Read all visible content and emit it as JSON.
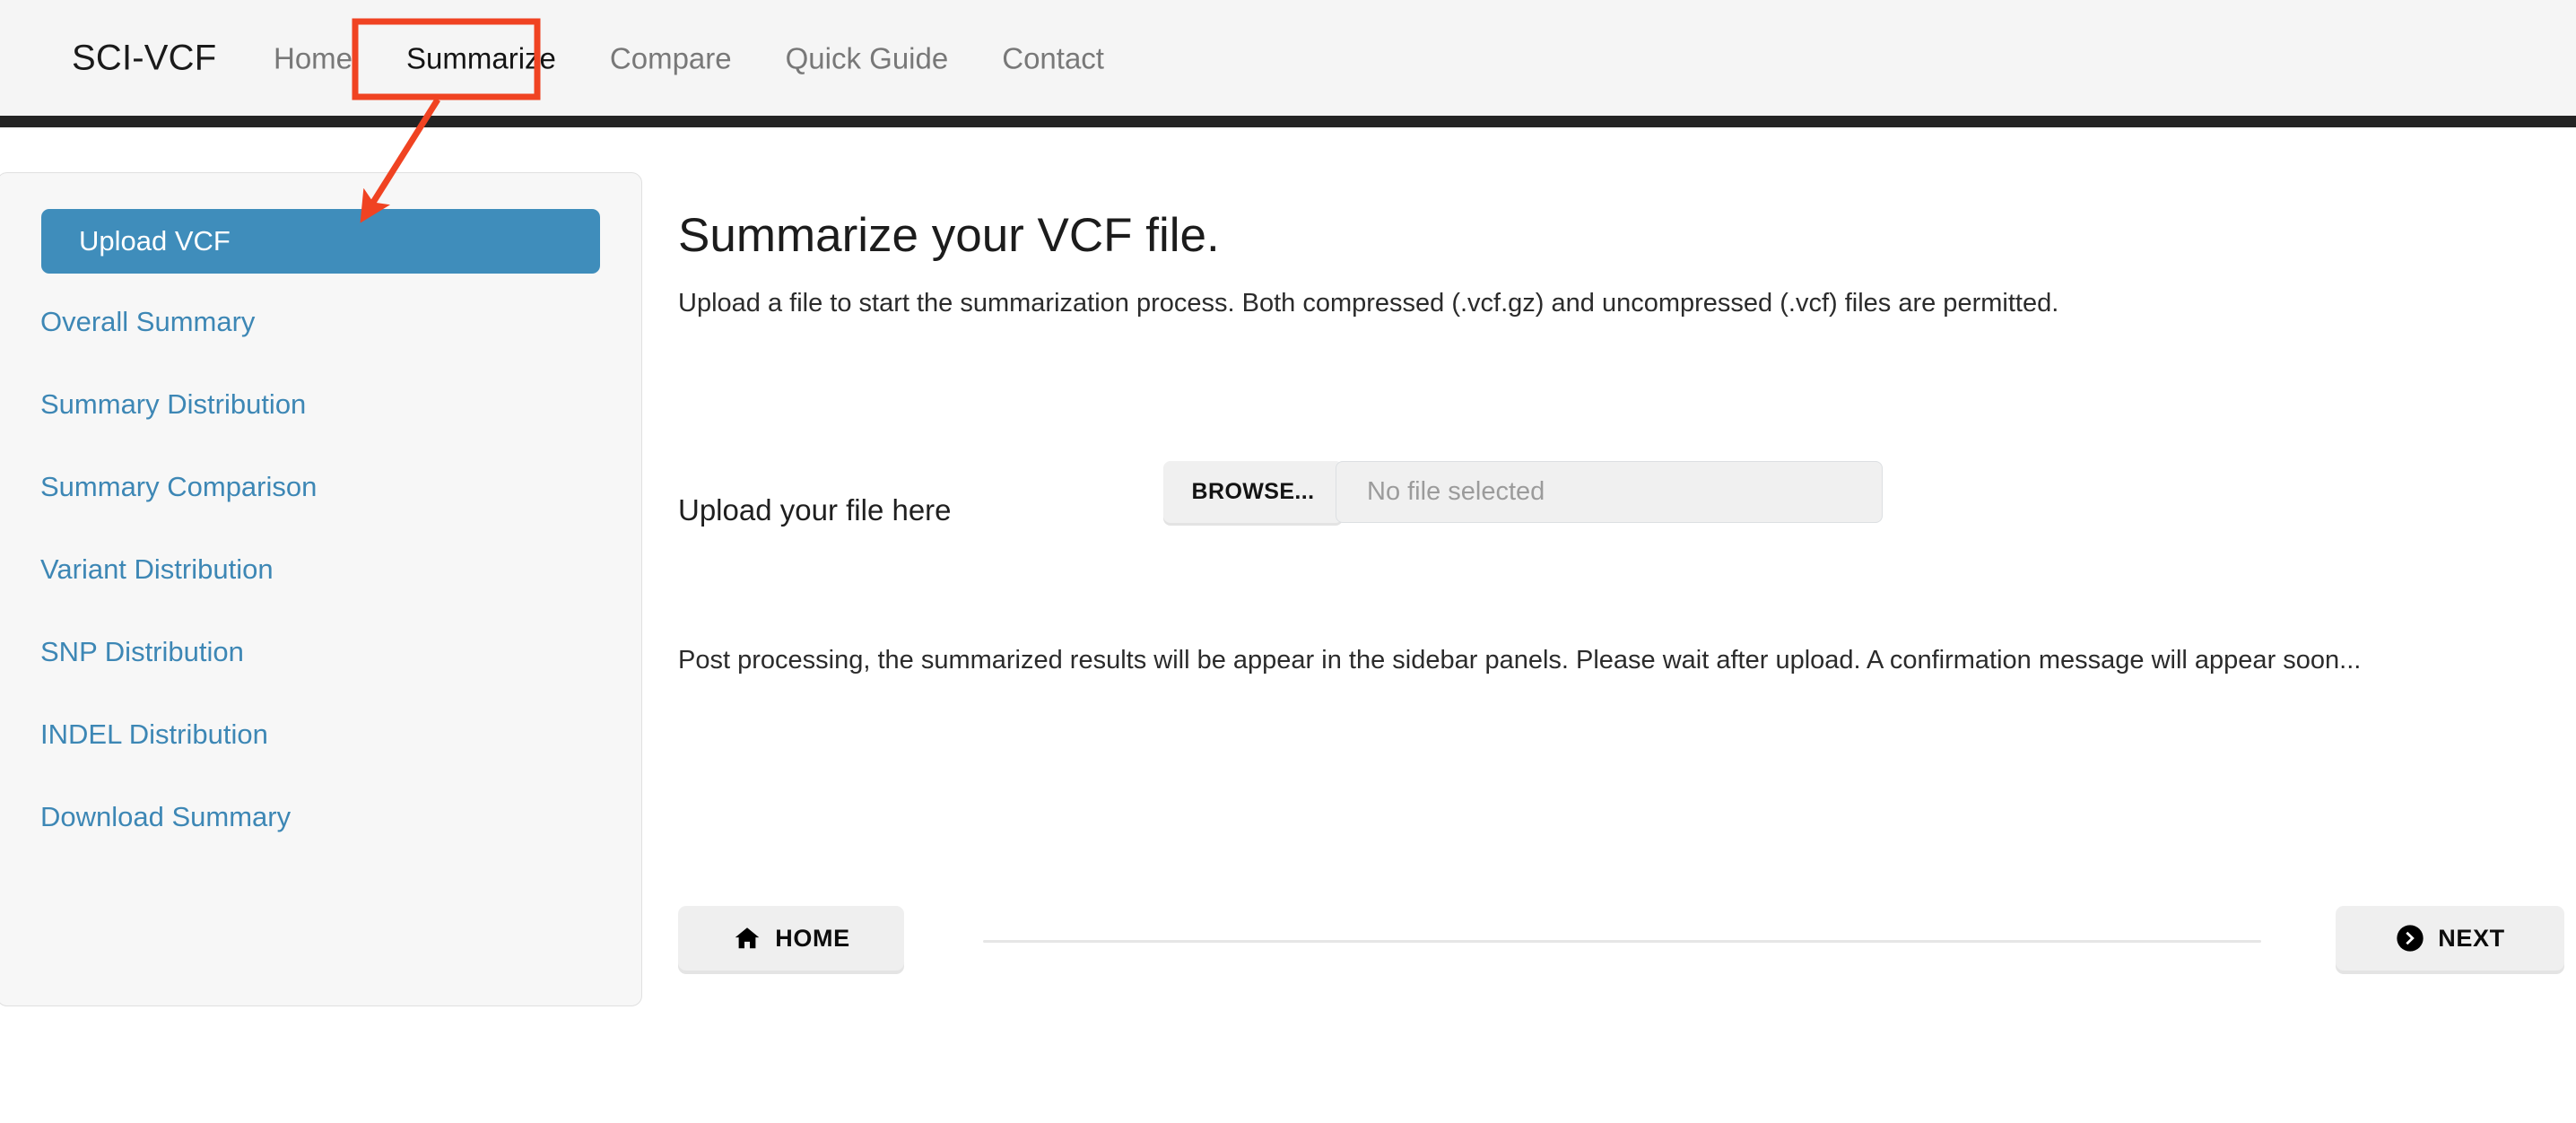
{
  "navbar": {
    "brand": "SCI-VCF",
    "links": [
      {
        "label": "Home",
        "active": false
      },
      {
        "label": "Summarize",
        "active": true
      },
      {
        "label": "Compare",
        "active": false
      },
      {
        "label": "Quick Guide",
        "active": false
      },
      {
        "label": "Contact",
        "active": false
      }
    ]
  },
  "sidebar": {
    "items": [
      {
        "label": "Upload VCF",
        "active": true
      },
      {
        "label": "Overall Summary",
        "active": false
      },
      {
        "label": "Summary Distribution",
        "active": false
      },
      {
        "label": "Summary Comparison",
        "active": false
      },
      {
        "label": "Variant Distribution",
        "active": false
      },
      {
        "label": "SNP Distribution",
        "active": false
      },
      {
        "label": "INDEL Distribution",
        "active": false
      },
      {
        "label": "Download Summary",
        "active": false
      }
    ]
  },
  "main": {
    "title": "Summarize your VCF file.",
    "subtitle": "Upload a file to start the summarization process. Both compressed (.vcf.gz) and uncompressed (.vcf) files are permitted.",
    "upload": {
      "label": "Upload your file here",
      "browse_label": "BROWSE...",
      "file_value": "No file selected"
    },
    "post_note": "Post processing, the summarized results will be appear in the sidebar panels. Please wait after upload. A confirmation message will appear soon...",
    "footer": {
      "home_label": "HOME",
      "home_icon": "home-icon",
      "next_label": "NEXT",
      "next_icon": "chevron-right-circle-icon"
    }
  },
  "annotation": {
    "target_label": "Summarize",
    "color": "#f04322"
  },
  "colors": {
    "accent_blue": "#3f8dbb",
    "link_blue": "#3d87b5",
    "navbar_bg": "#f5f5f5",
    "navbar_bar": "#242424",
    "sidebar_bg": "#f7f7f7",
    "annotation_red": "#f04322"
  }
}
